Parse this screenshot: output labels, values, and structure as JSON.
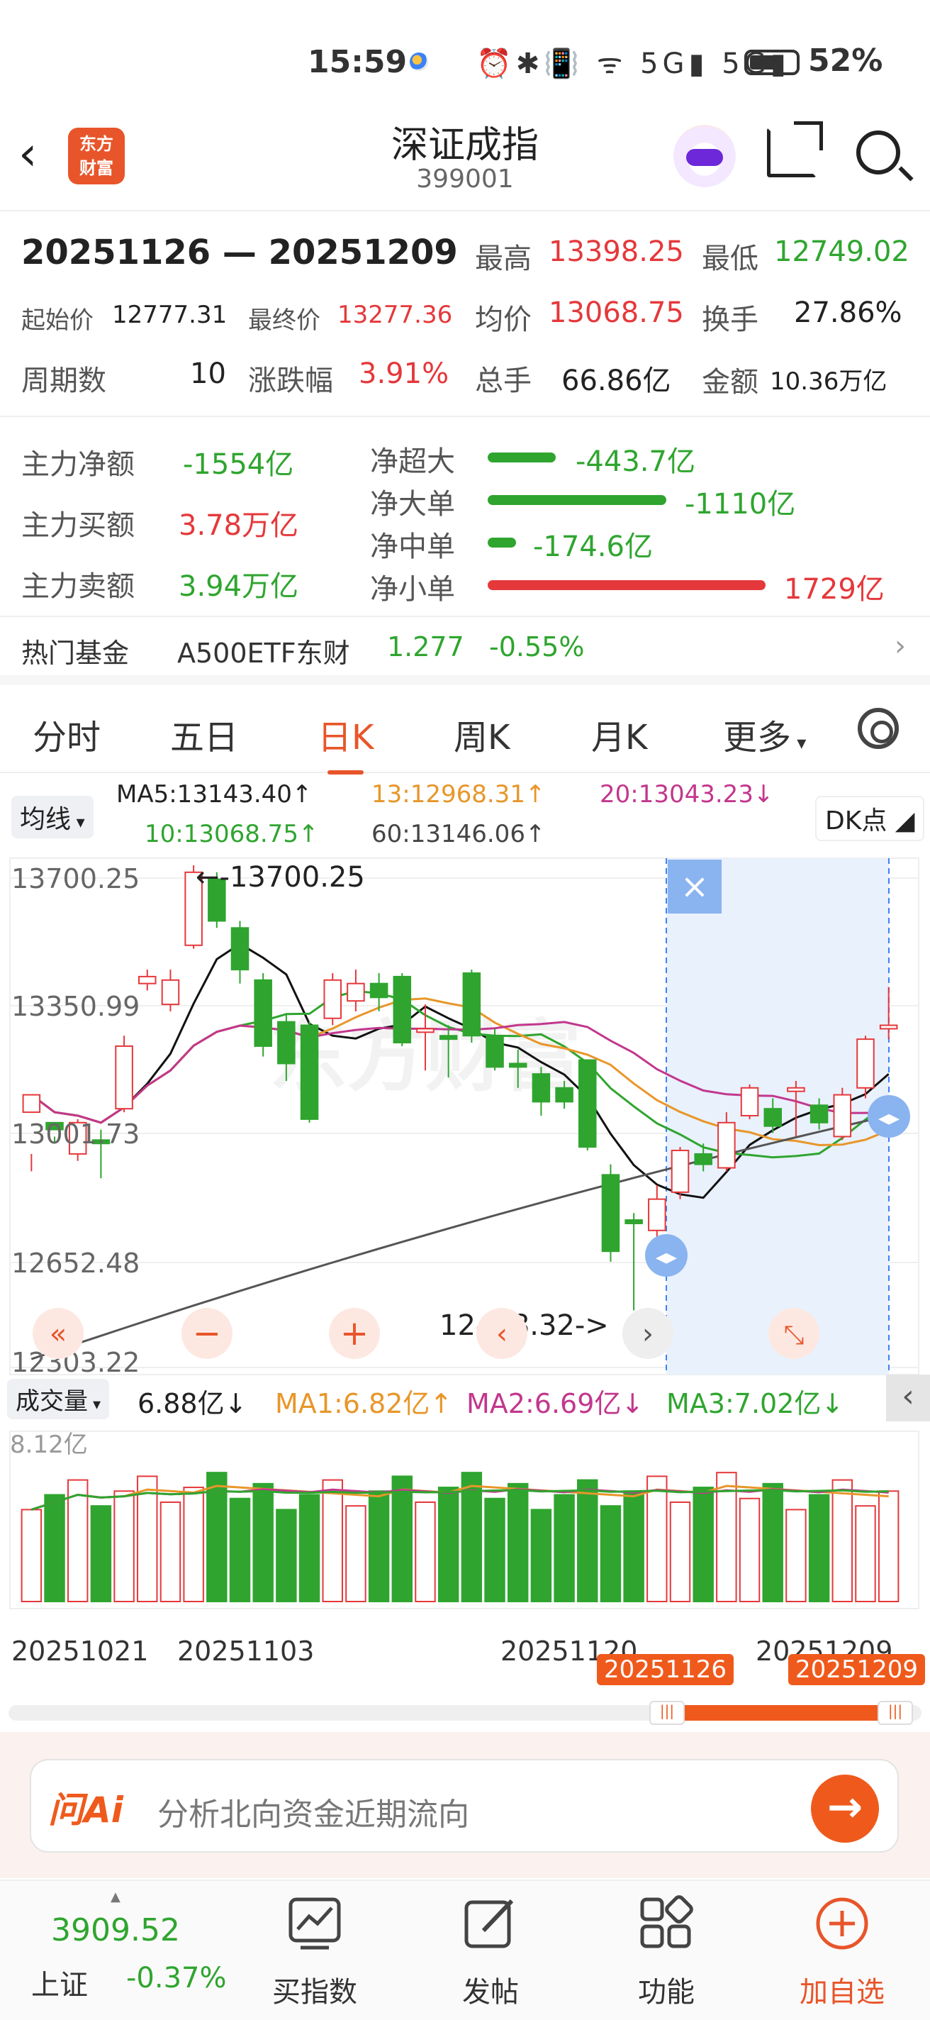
{
  "status_bar": {
    "time": "15:59",
    "icons": "⏰✱📳 ᯤ 5G▮ 5G▮",
    "battery": "52%"
  },
  "header": {
    "title": "深证成指",
    "code": "399001",
    "logo_text_1": "东方",
    "logo_text_2": "财富"
  },
  "stats": {
    "range": "20251126 — 20251209",
    "high_label": "最高",
    "high": "13398.25",
    "low_label": "最低",
    "low": "12749.02",
    "open_label": "起始价",
    "open": "12777.31",
    "close_label": "最终价",
    "close": "13277.36",
    "avg_label": "均价",
    "avg": "13068.75",
    "turnover_label": "换手",
    "turnover": "27.86%",
    "periods_label": "周期数",
    "periods": "10",
    "change_label": "涨跌幅",
    "change": "3.91%",
    "volume_label": "总手",
    "volume": "66.86亿",
    "amount_label": "金额",
    "amount": "10.36万亿"
  },
  "flow": {
    "net_label": "主力净额",
    "net": "-1554亿",
    "buy_label": "主力买额",
    "buy": "3.78万亿",
    "sell_label": "主力卖额",
    "sell": "3.94万亿",
    "rows": [
      {
        "label": "净超大",
        "value": "-443.7亿",
        "color": "#2fa52f"
      },
      {
        "label": "净大单",
        "value": "-1110亿",
        "color": "#2fa52f"
      },
      {
        "label": "净中单",
        "value": "-174.6亿",
        "color": "#2fa52f"
      },
      {
        "label": "净小单",
        "value": "1729亿",
        "color": "#e5383b"
      }
    ]
  },
  "fund": {
    "label": "热门基金",
    "name": "A500ETF东财",
    "price": "1.277",
    "change": "-0.55%"
  },
  "tabs": [
    "分时",
    "五日",
    "日K",
    "周K",
    "月K",
    "更多"
  ],
  "active_tab": "日K",
  "ma_bar": {
    "selector": "均线",
    "ma5": "MA5:13143.40↑",
    "ma13": "13:12968.31↑",
    "ma20": "20:13043.23↓",
    "ma10": "10:13068.75↑",
    "ma60": "60:13146.06↑",
    "dk": "DK点"
  },
  "chart_data": {
    "type": "candlestick",
    "y_ticks": [
      "13700.25",
      "13350.99",
      "13001.73",
      "12652.48",
      "12303.22"
    ],
    "max_label": "←-13700.25",
    "min_label": "12448.32->",
    "selection": {
      "start": "20251126",
      "end": "20251209"
    },
    "candles": [
      [
        13010,
        13060,
        12890,
        12840
      ],
      [
        12980,
        12960,
        12940,
        12920
      ],
      [
        12890,
        12980,
        12990,
        12870
      ],
      [
        12930,
        12920,
        12960,
        12820
      ],
      [
        13020,
        13200,
        13230,
        13010
      ],
      [
        13380,
        13400,
        13420,
        13360
      ],
      [
        13320,
        13390,
        13420,
        13300
      ],
      [
        13490,
        13700,
        13720,
        13480
      ],
      [
        13680,
        13560,
        13700,
        13540
      ],
      [
        13540,
        13420,
        13560,
        13380
      ],
      [
        13390,
        13200,
        13410,
        13170
      ],
      [
        13270,
        13150,
        13290,
        13100
      ],
      [
        13260,
        12990,
        13270,
        12980
      ],
      [
        13280,
        13390,
        13410,
        13260
      ],
      [
        13330,
        13380,
        13420,
        13300
      ],
      [
        13380,
        13340,
        13410,
        13300
      ],
      [
        13400,
        13210,
        13410,
        13200
      ],
      [
        13240,
        13250,
        13320,
        13130
      ],
      [
        13230,
        13220,
        13260,
        13110
      ],
      [
        13410,
        13230,
        13420,
        13210
      ],
      [
        13230,
        13140,
        13250,
        13130
      ],
      [
        13150,
        13140,
        13190,
        13080
      ],
      [
        13120,
        13040,
        13140,
        13000
      ],
      [
        13080,
        13040,
        13100,
        13020
      ],
      [
        13160,
        12910,
        13160,
        12900
      ],
      [
        12830,
        12610,
        12860,
        12580
      ],
      [
        12700,
        12690,
        12720,
        12440
      ],
      [
        12670,
        12760,
        12800,
        12640
      ],
      [
        12780,
        12900,
        12910,
        12760
      ],
      [
        12890,
        12860,
        12920,
        12840
      ],
      [
        12850,
        12980,
        13010,
        12840
      ],
      [
        13000,
        13080,
        13090,
        12990
      ],
      [
        13020,
        12970,
        13050,
        12950
      ],
      [
        13070,
        13080,
        13100,
        12940
      ],
      [
        13030,
        12980,
        13050,
        12960
      ],
      [
        12940,
        13060,
        13080,
        12930
      ],
      [
        13080,
        13220,
        13230,
        13050
      ],
      [
        13250,
        13260,
        13370,
        13220
      ]
    ],
    "volume": {
      "label": "成交量",
      "value": "6.88亿↓",
      "ma1": "MA1:6.82亿↑",
      "ma2": "MA2:6.69亿↓",
      "ma3": "MA3:7.02亿↓",
      "top_label": "8.12亿"
    },
    "x_labels": [
      "20251021",
      "20251103",
      "20251120",
      "20251209"
    ]
  },
  "range_tags": {
    "start": "20251126",
    "end": "20251209"
  },
  "ai": {
    "logo": "问Ai",
    "prompt": "分析北向资金近期流向"
  },
  "bottom": {
    "index_name": "上证",
    "index_price": "3909.52",
    "index_change": "-0.37%",
    "items": [
      "买指数",
      "发帖",
      "功能",
      "加自选"
    ]
  },
  "colors": {
    "up": "#e5383b",
    "down": "#2fa52f",
    "accent": "#e8552a"
  }
}
